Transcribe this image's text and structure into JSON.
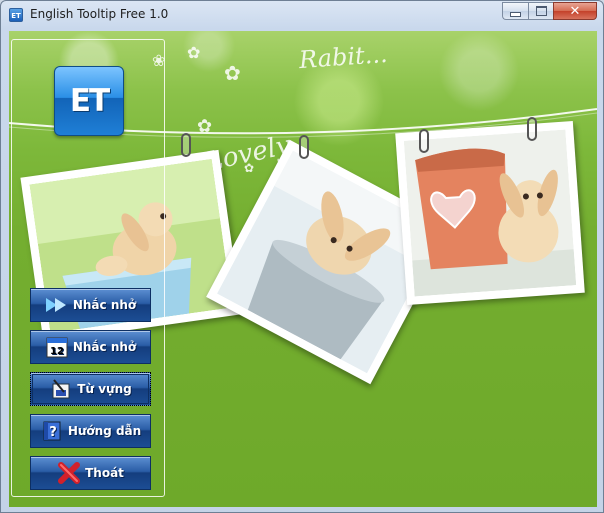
{
  "window": {
    "title": "English Tooltip Free 1.0",
    "app_icon_text": "ET",
    "controls": {
      "minimize": "minimize",
      "maximize": "maximize",
      "close": "close"
    }
  },
  "app": {
    "logo_text": "ET",
    "decor": {
      "rabit": "Rabit...",
      "lovely": "Lovely"
    },
    "menu": [
      {
        "label": "Nhắc nhở",
        "icon": "play-arrows-icon"
      },
      {
        "label": "Nhắc nhở",
        "icon": "calendar-icon",
        "icon_text": "12"
      },
      {
        "label": "Từ vựng",
        "icon": "book-pen-icon"
      },
      {
        "label": "Hướng dẫn",
        "icon": "help-book-icon"
      },
      {
        "label": "Thoát",
        "icon": "red-x-icon"
      }
    ]
  },
  "colors": {
    "background_green": "#74ae30",
    "button_blue": "#1c4d94",
    "exit_red": "#d2202a"
  }
}
